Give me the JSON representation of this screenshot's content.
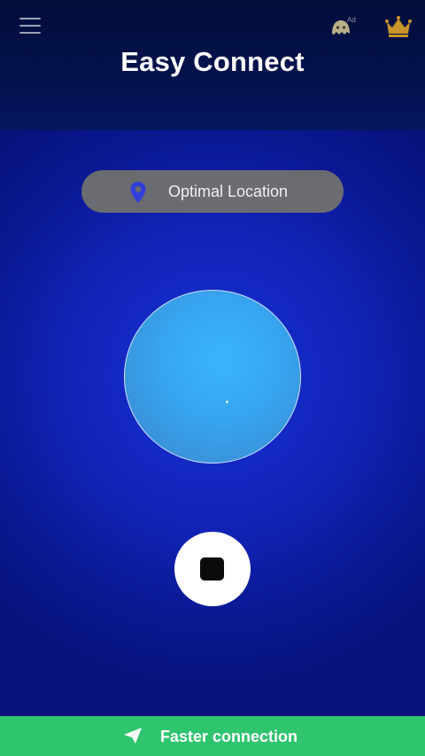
{
  "header": {
    "title": "Easy Connect",
    "menu_icon": "hamburger-menu-icon",
    "ad_icon": "ghost-icon",
    "ad_badge": "Ad",
    "premium_icon": "crown-icon"
  },
  "location": {
    "icon": "location-pin-icon",
    "label": "Optimal Location"
  },
  "connect": {
    "globe_icon": "globe-button",
    "stop_icon": "stop-icon"
  },
  "footer": {
    "icon": "paper-plane-icon",
    "label": "Faster connection"
  },
  "colors": {
    "header_bg": "#04124d",
    "main_bg": "#1124b8",
    "pill_bg": "#6b6b72",
    "globe": "#37a6f2",
    "crown": "#c8932a",
    "footer_bg": "#2fc46e"
  }
}
